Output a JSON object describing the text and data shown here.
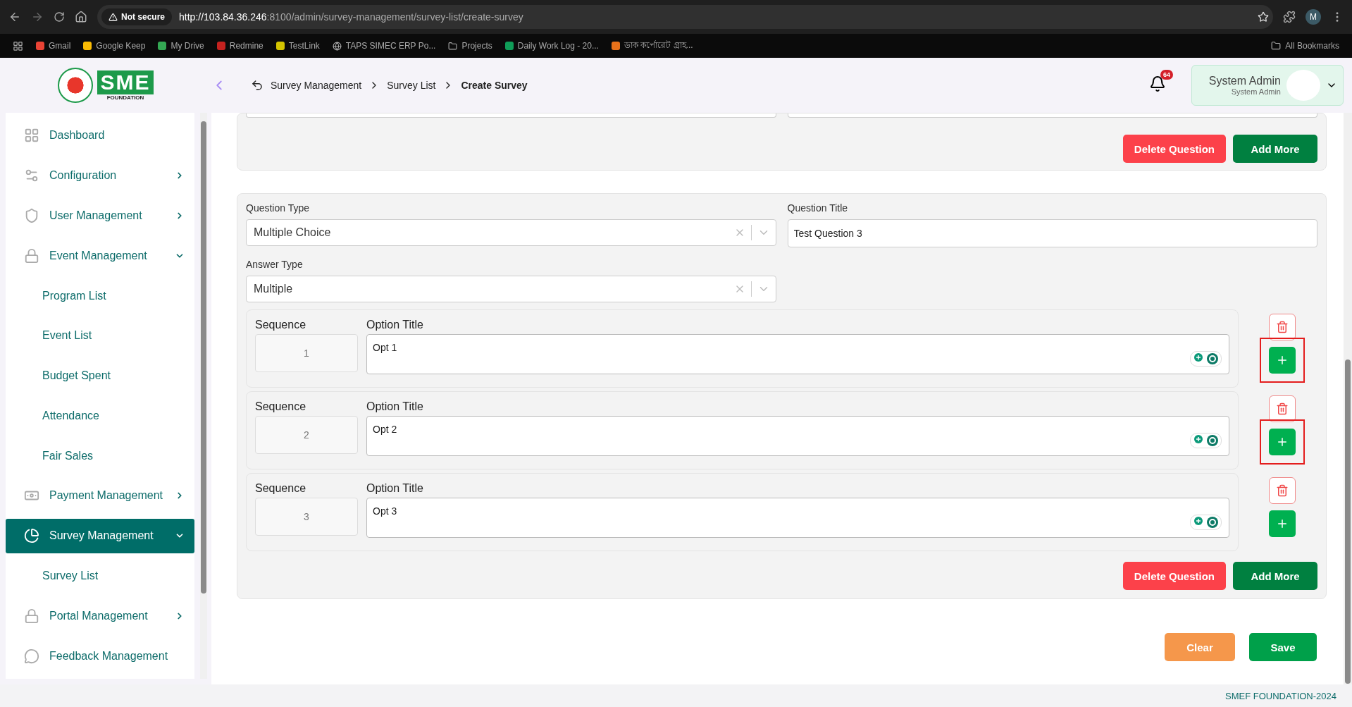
{
  "browser": {
    "security": "Not secure",
    "url_host": "http://103.84.36.246",
    "url_path": ":8100/admin/survey-management/survey-list/create-survey",
    "profile": "M",
    "bookmarks": [
      "Gmail",
      "Google Keep",
      "My Drive",
      "Redmine",
      "TestLink",
      "TAPS SIMEC ERP Po...",
      "Projects",
      "Daily Work Log - 20...",
      "ডাক কর্পোরেট গ্রাহ..."
    ],
    "all_bookmarks": "All Bookmarks"
  },
  "logo": {
    "letters": "SME",
    "subtitle": "FOUNDATION"
  },
  "breadcrumb": [
    {
      "label": "Survey Management",
      "current": false
    },
    {
      "label": "Survey List",
      "current": false
    },
    {
      "label": "Create Survey",
      "current": true
    }
  ],
  "notifications": {
    "count": "64"
  },
  "user": {
    "name": "System Admin",
    "role": "System Admin"
  },
  "sidebar": {
    "items": [
      {
        "label": "Dashboard",
        "selected": false,
        "has_arrow": false,
        "expanded": false
      },
      {
        "label": "Configuration",
        "selected": false,
        "has_arrow": true,
        "expanded": false
      },
      {
        "label": "User Management",
        "selected": false,
        "has_arrow": true,
        "expanded": false
      },
      {
        "label": "Event Management",
        "selected": false,
        "has_arrow": true,
        "expanded": true,
        "children": [
          {
            "label": "Program List"
          },
          {
            "label": "Event List"
          },
          {
            "label": "Budget Spent"
          },
          {
            "label": "Attendance"
          },
          {
            "label": "Fair Sales"
          }
        ]
      },
      {
        "label": "Payment Management",
        "selected": false,
        "has_arrow": true,
        "expanded": false
      },
      {
        "label": "Survey Management",
        "selected": true,
        "has_arrow": true,
        "expanded": true,
        "children": [
          {
            "label": "Survey List"
          }
        ]
      },
      {
        "label": "Portal Management",
        "selected": false,
        "has_arrow": true,
        "expanded": false
      },
      {
        "label": "Feedback Management",
        "selected": false,
        "has_arrow": false,
        "expanded": false
      }
    ]
  },
  "previous_question": {
    "buttons": [
      "Delete Question",
      "Add More"
    ]
  },
  "question": {
    "type_label": "Question Type",
    "type_value": "Multiple Choice",
    "title_label": "Question Title",
    "title_value": "Test Question 3",
    "answer_label": "Answer Type",
    "answer_value": "Multiple",
    "options": [
      {
        "sequence_label": "Sequence",
        "sequence": "1",
        "title_label": "Option Title",
        "title": "Opt 1",
        "highlighted": true
      },
      {
        "sequence_label": "Sequence",
        "sequence": "2",
        "title_label": "Option Title",
        "title": "Opt 2",
        "highlighted": true
      },
      {
        "sequence_label": "Sequence",
        "sequence": "3",
        "title_label": "Option Title",
        "title": "Opt 3",
        "highlighted": false
      }
    ],
    "buttons": [
      "Delete Question",
      "Add More"
    ]
  },
  "form_buttons": [
    "Clear",
    "Save"
  ],
  "footer": "SMEF FOUNDATION-2024"
}
